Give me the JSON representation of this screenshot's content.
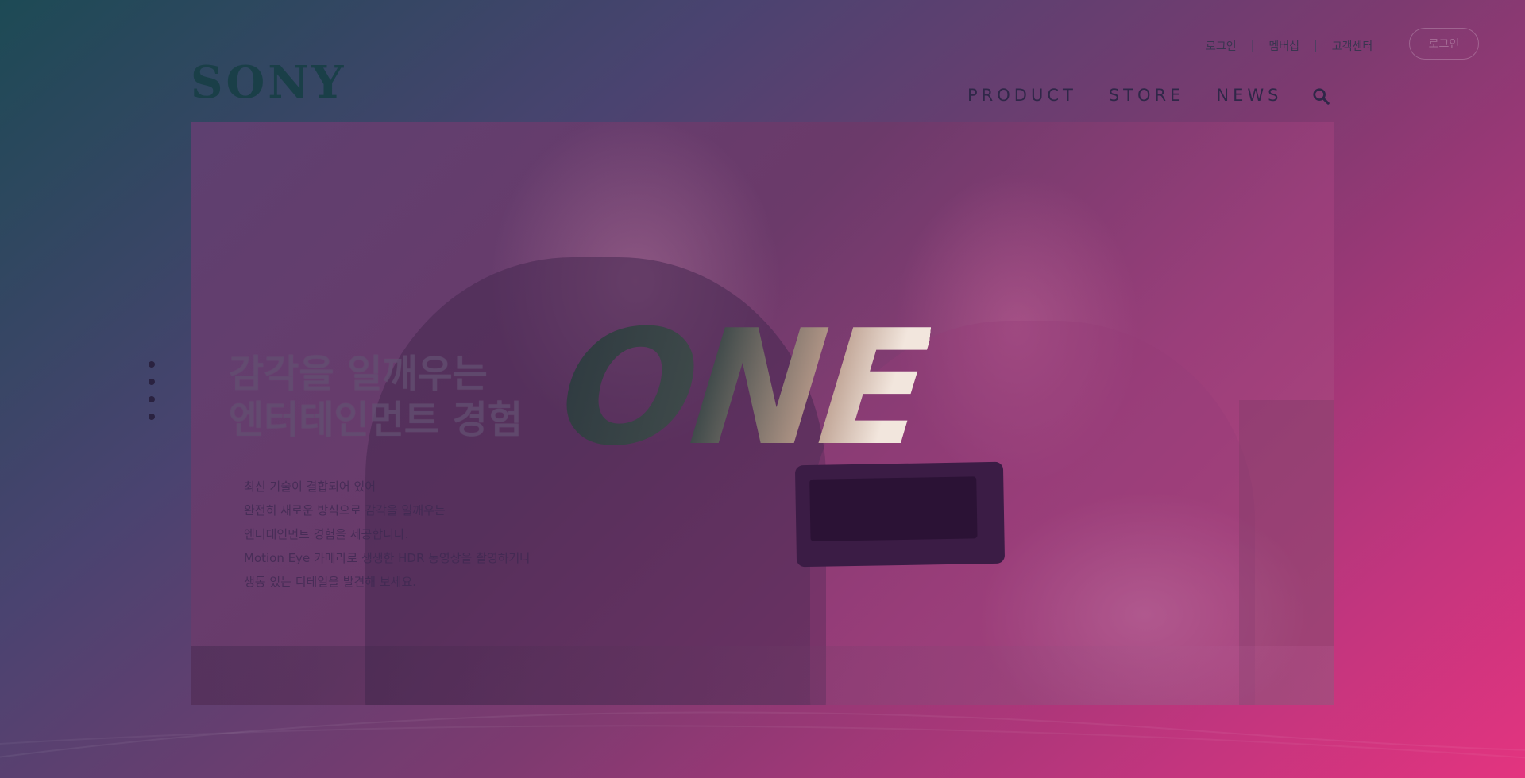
{
  "header": {
    "logo": "SONY",
    "util_links": [
      "로그인",
      "멤버십",
      "고객센터"
    ],
    "separator": "|",
    "login_button": "로그인",
    "nav": [
      "PRODUCT",
      "STORE",
      "NEWS"
    ],
    "search_icon": "search-icon"
  },
  "hero": {
    "overlay_word": "ONE",
    "headline_line1": "감각을 일깨우는",
    "headline_line2": "엔터테인먼트 경험",
    "body": [
      "최신 기술이 결합되어 있어",
      "완전히 새로운 방식으로 감각을 일깨우는",
      "엔터테인먼트 경험을 제공합니다.",
      "Motion Eye 카메라로 생생한 HDR 동영상을 촬영하거나",
      "생동 있는 디테일을 발견해 보세요."
    ],
    "pager_dots": 4
  },
  "colors": {
    "gradient_start": "#1d4a55",
    "gradient_end": "#e3347f",
    "logo": "#1a3f48"
  }
}
